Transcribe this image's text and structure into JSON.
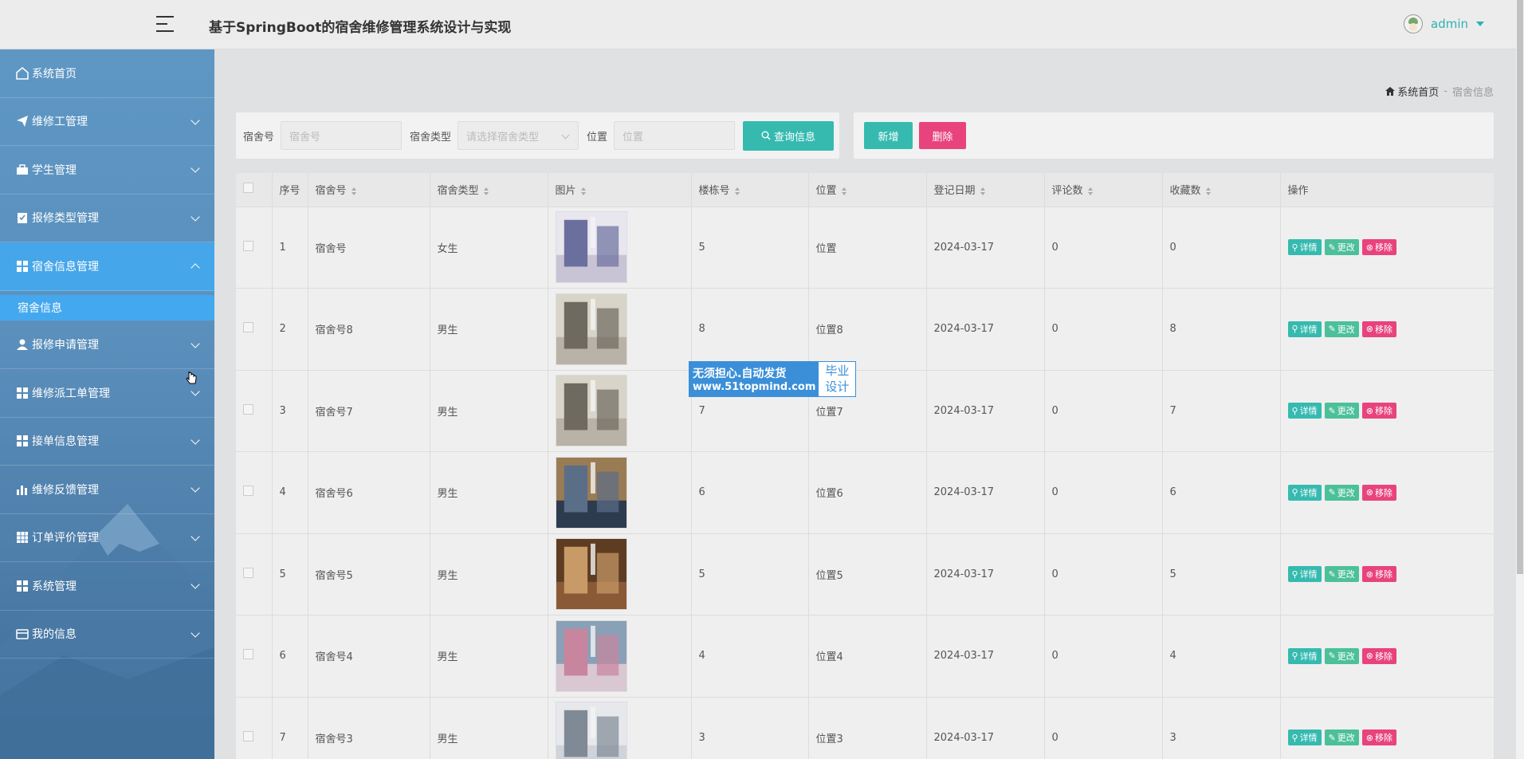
{
  "header": {
    "app_title": "基于SpringBoot的宿舍维修管理系统设计与实现",
    "username": "admin"
  },
  "sidebar": {
    "items": [
      {
        "label": "系统首页",
        "icon": "home-icon"
      },
      {
        "label": "维修工管理",
        "icon": "paper-plane-icon"
      },
      {
        "label": "学生管理",
        "icon": "briefcase-icon"
      },
      {
        "label": "报修类型管理",
        "icon": "clipboard-check-icon"
      },
      {
        "label": "宿舍信息管理",
        "icon": "grid-icon"
      },
      {
        "label": "报修申请管理",
        "icon": "user-icon"
      },
      {
        "label": "维修派工单管理",
        "icon": "grid-icon"
      },
      {
        "label": "接单信息管理",
        "icon": "grid-icon"
      },
      {
        "label": "维修反馈管理",
        "icon": "bar-chart-icon"
      },
      {
        "label": "订单评价管理",
        "icon": "table-icon"
      },
      {
        "label": "系统管理",
        "icon": "grid-icon"
      },
      {
        "label": "我的信息",
        "icon": "wallet-icon"
      }
    ],
    "active_sub": "宿舍信息"
  },
  "breadcrumb": {
    "home": "系统首页",
    "separator": "-",
    "current": "宿舍信息"
  },
  "search": {
    "dorm_no_label": "宿舍号",
    "dorm_no_placeholder": "宿舍号",
    "dorm_type_label": "宿舍类型",
    "dorm_type_placeholder": "请选择宿舍类型",
    "location_label": "位置",
    "location_placeholder": "位置",
    "query_button": "查询信息"
  },
  "actions": {
    "add": "新增",
    "delete": "删除"
  },
  "table": {
    "columns": [
      "序号",
      "宿舍号",
      "宿舍类型",
      "图片",
      "楼栋号",
      "位置",
      "登记日期",
      "评论数",
      "收藏数",
      "操作"
    ],
    "op_labels": {
      "detail": "详情",
      "edit": "更改",
      "remove": "移除"
    },
    "rows": [
      {
        "idx": "1",
        "dorm_no": "宿舍号",
        "type": "女生",
        "building": "5",
        "location": "位置",
        "date": "2024-03-17",
        "comments": "0",
        "favorites": "0"
      },
      {
        "idx": "2",
        "dorm_no": "宿舍号8",
        "type": "男生",
        "building": "8",
        "location": "位置8",
        "date": "2024-03-17",
        "comments": "0",
        "favorites": "8"
      },
      {
        "idx": "3",
        "dorm_no": "宿舍号7",
        "type": "男生",
        "building": "7",
        "location": "位置7",
        "date": "2024-03-17",
        "comments": "0",
        "favorites": "7"
      },
      {
        "idx": "4",
        "dorm_no": "宿舍号6",
        "type": "男生",
        "building": "6",
        "location": "位置6",
        "date": "2024-03-17",
        "comments": "0",
        "favorites": "6"
      },
      {
        "idx": "5",
        "dorm_no": "宿舍号5",
        "type": "男生",
        "building": "5",
        "location": "位置5",
        "date": "2024-03-17",
        "comments": "0",
        "favorites": "5"
      },
      {
        "idx": "6",
        "dorm_no": "宿舍号4",
        "type": "男生",
        "building": "4",
        "location": "位置4",
        "date": "2024-03-17",
        "comments": "0",
        "favorites": "4"
      },
      {
        "idx": "7",
        "dorm_no": "宿舍号3",
        "type": "男生",
        "building": "3",
        "location": "位置3",
        "date": "2024-03-17",
        "comments": "0",
        "favorites": "3"
      }
    ]
  },
  "watermark": {
    "line1": "无须担心.自动发货",
    "line2": "www.51topmind.com",
    "right": "毕业设计"
  },
  "colors": {
    "accent_teal": "#36bab0",
    "danger_pink": "#e8437d",
    "sidebar_blue": "#5b8fbc",
    "active_blue": "#46a6ea"
  }
}
